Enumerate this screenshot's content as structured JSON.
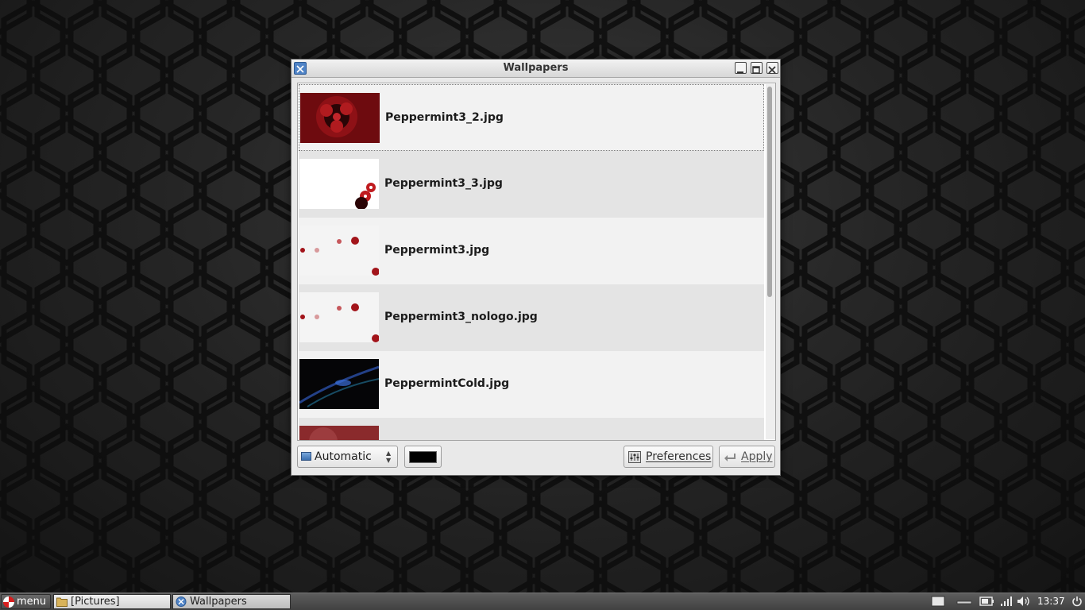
{
  "window": {
    "title": "Wallpapers"
  },
  "wallpapers": [
    {
      "name": "Peppermint3_2.jpg",
      "selected": true
    },
    {
      "name": "Peppermint3_3.jpg",
      "selected": false
    },
    {
      "name": "Peppermint3.jpg",
      "selected": false
    },
    {
      "name": "Peppermint3_nologo.jpg",
      "selected": false
    },
    {
      "name": "PeppermintCold.jpg",
      "selected": false
    },
    {
      "name": "",
      "selected": false
    }
  ],
  "toolbar": {
    "mode_value": "Automatic",
    "background_color": "#000000",
    "preferences_label": "Preferences",
    "apply_label": "Apply"
  },
  "taskbar": {
    "menu_label": "menu",
    "tasks": [
      {
        "label": "[Pictures]",
        "icon": "folder-icon"
      },
      {
        "label": "Wallpapers",
        "icon": "wallpapers-app-icon"
      }
    ],
    "clock": "13:37"
  },
  "colors": {
    "accent_red": "#b3121b",
    "title_bar": "#e0e0e0",
    "taskbar": "#4a4a4a"
  }
}
